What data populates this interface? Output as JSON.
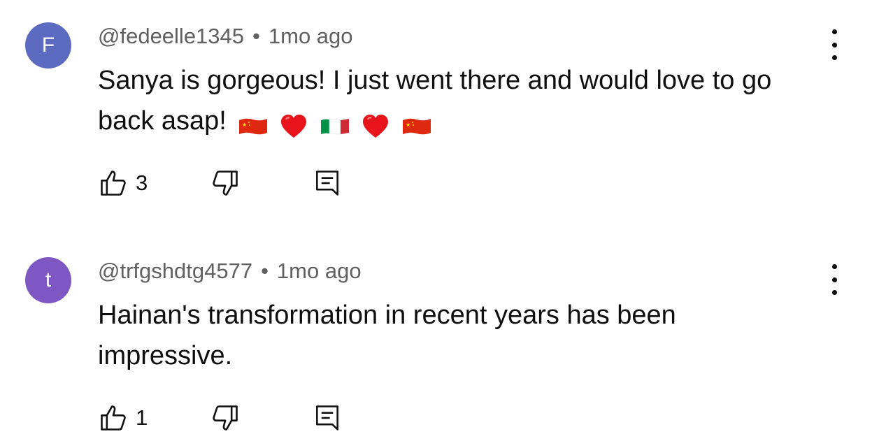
{
  "colors": {
    "avatar_1": "#5c6bc0",
    "avatar_2": "#7e57c2",
    "text": "#0f0f0f",
    "meta": "#606060"
  },
  "comments": [
    {
      "avatar_letter": "F",
      "author": "@fedeelle1345",
      "separator": "•",
      "time": "1mo ago",
      "text": "Sanya is gorgeous! I just went there and would love to go back asap!",
      "emojis": [
        "china-flag-icon",
        "red-heart-icon",
        "italy-flag-icon",
        "red-heart-icon",
        "china-flag-icon"
      ],
      "likes": "3"
    },
    {
      "avatar_letter": "t",
      "author": "@trfgshdtg4577",
      "separator": "•",
      "time": "1mo ago",
      "text": "Hainan's transformation in recent years has been impressive.",
      "emojis": [],
      "likes": "1"
    }
  ]
}
